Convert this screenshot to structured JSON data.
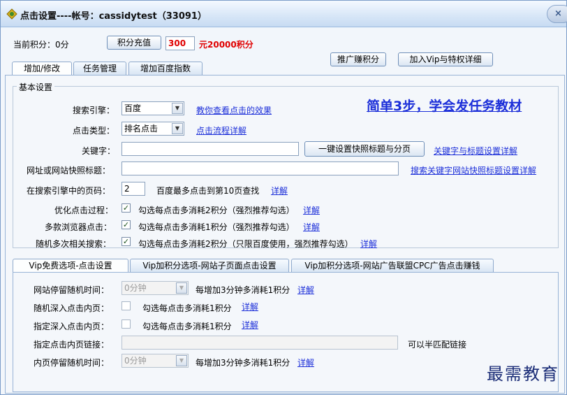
{
  "window": {
    "title": "点击设置----帐号：cassidytest（33091）",
    "close_label": "×",
    "colors": {
      "accent": "#1c2fd9",
      "alert": "#e00000",
      "title_bg": "#d7e6f7"
    }
  },
  "top": {
    "points_label": "当前积分：0分",
    "recharge_button": "积分充值",
    "recharge_value": "300",
    "recharge_price": "元20000积分",
    "referral_button": "推广赚积分",
    "vip_button": "加入Vip与特权详细"
  },
  "main_tabs": [
    {
      "label": "增加/修改"
    },
    {
      "label": "任务管理"
    },
    {
      "label": "增加百度指数"
    }
  ],
  "basic": {
    "group_label": "基本设置",
    "tutorial_link": "简单3步，学会发任务教材",
    "search_engine": {
      "label": "搜索引擎：",
      "value": "百度",
      "link": "教你查看点击的效果"
    },
    "click_type": {
      "label": "点击类型：",
      "value": "排名点击",
      "link": "点击流程详解"
    },
    "keyword": {
      "label": "关键字：",
      "value": "",
      "button": "一键设置快照标题与分页",
      "link": "关键字与标题设置详解"
    },
    "snapshot_title": {
      "label": "网址或网站快照标题：",
      "value": "",
      "link": "搜索关键字网站快照标题设置详解"
    },
    "page": {
      "label": "在搜索引擎中的页码：",
      "value": "2",
      "hint": "百度最多点击到第10页查找",
      "link": "详解"
    },
    "optimize": {
      "label": "优化点击过程：",
      "checked": true,
      "text": "勾选每点击多消耗2积分（强烈推荐勾选）",
      "link": "详解"
    },
    "browsers": {
      "label": "多款浏览器点击：",
      "checked": true,
      "text": "勾选每点击多消耗1积分（强烈推荐勾选）",
      "link": "详解"
    },
    "random_search": {
      "label": "随机多次相关搜索：",
      "checked": true,
      "text": "勾选每点击多消耗2积分（只限百度使用，强烈推荐勾选）",
      "link": "详解"
    }
  },
  "vip_tabs": [
    {
      "label": "Vip免费选项-点击设置"
    },
    {
      "label": "Vip加积分选项-网站子页面点击设置"
    },
    {
      "label": "Vip加积分选项-网站广告联盟CPC广告点击赚钱"
    }
  ],
  "vip": {
    "stay_time": {
      "label": "网站停留随机时间：",
      "value": "0分钟",
      "text": "每增加3分钟多消耗1积分",
      "link": "详解"
    },
    "random_deep": {
      "label": "随机深入点击内页：",
      "checked": false,
      "text": "勾选每点击多消耗1积分",
      "link": "详解"
    },
    "fixed_deep": {
      "label": "指定深入点击内页：",
      "checked": false,
      "text": "勾选每点击多消耗1积分",
      "link": "详解"
    },
    "inner_link": {
      "label": "指定点击内页链接：",
      "value": "",
      "hint": "可以半匹配链接"
    },
    "inner_stay": {
      "label": "内页停留随机时间：",
      "value": "0分钟",
      "text": "每增加3分钟多消耗1积分",
      "link": "详解"
    }
  },
  "watermark": "最需教育"
}
